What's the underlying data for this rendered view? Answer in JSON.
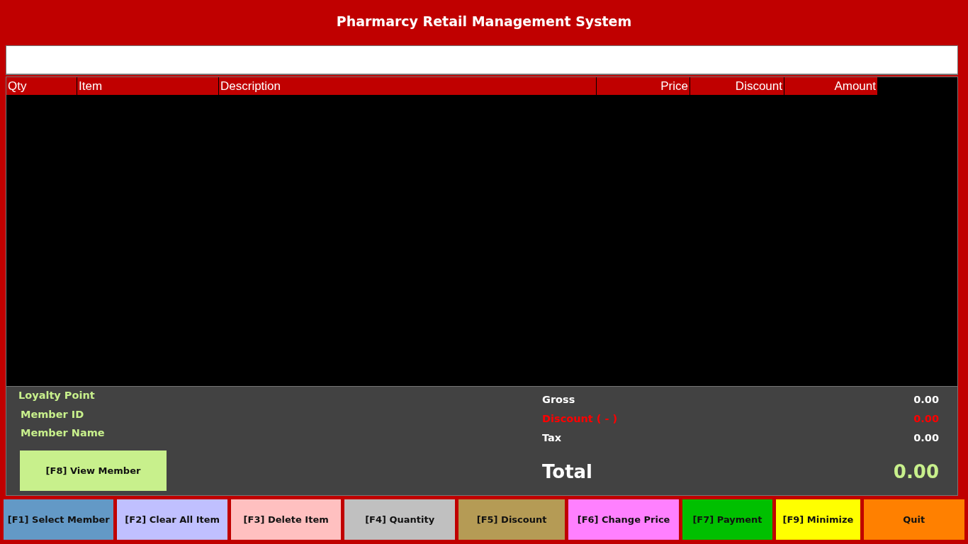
{
  "window": {
    "title": "Pharmarcy Retail Management System"
  },
  "table": {
    "columns": [
      {
        "label": "Qty"
      },
      {
        "label": "Item"
      },
      {
        "label": "Description"
      },
      {
        "label": "Price"
      },
      {
        "label": "Discount"
      },
      {
        "label": "Amount"
      }
    ]
  },
  "member": {
    "labels": [
      "Loyalty Point",
      "Member ID",
      "Member Name"
    ],
    "view_button": "[F8] View Member"
  },
  "totals": [
    {
      "label": "Gross",
      "value": "0.00",
      "kind": "normal"
    },
    {
      "label": "Discount ( - )",
      "value": "0.00",
      "kind": "negative"
    },
    {
      "label": "Tax",
      "value": "0.00",
      "kind": "normal"
    }
  ],
  "total": {
    "label": "Total",
    "value": "0.00"
  },
  "buttons": [
    {
      "label": "[F1] Select Member",
      "color": "#6399c6"
    },
    {
      "label": "[F2] Clear All Item",
      "color": "#c0c0ff"
    },
    {
      "label": "[F3] Delete Item",
      "color": "#ffc0c0"
    },
    {
      "label": "[F4] Quantity",
      "color": "#c0c0c0"
    },
    {
      "label": "[F5] Discount",
      "color": "#b59b55"
    },
    {
      "label": "[F6] Change Price",
      "color": "#ff80ff"
    },
    {
      "label": "[F7] Payment",
      "color": "#00c000"
    },
    {
      "label": "[F9] Minimize",
      "color": "#ffff00"
    },
    {
      "label": "Quit",
      "color": "#ff8000"
    }
  ]
}
